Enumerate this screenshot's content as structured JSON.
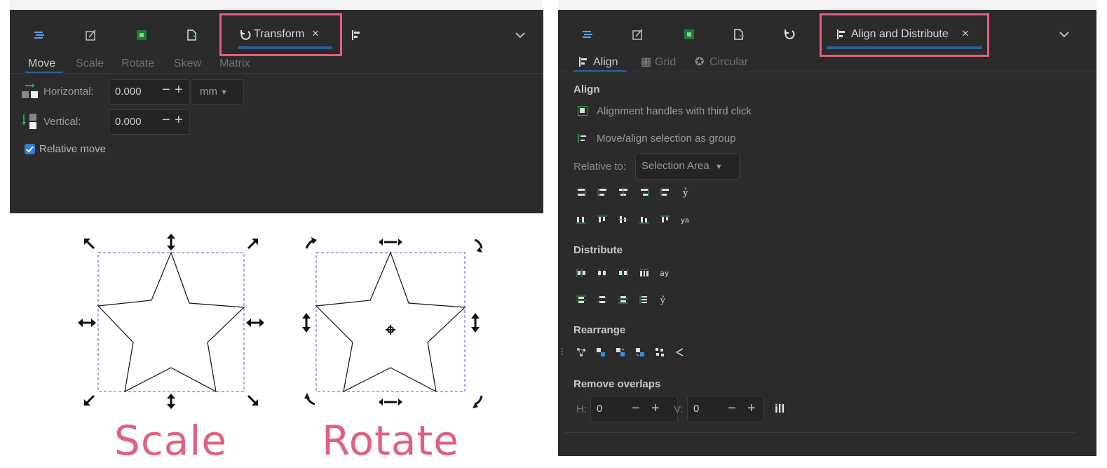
{
  "transform_panel": {
    "tab_label": "Transform",
    "close_glyph": "×",
    "subtabs": [
      "Move",
      "Scale",
      "Rotate",
      "Skew",
      "Matrix"
    ],
    "horizontal_label": "Horizontal:",
    "horizontal_value": "0.000",
    "vertical_label": "Vertical:",
    "vertical_value": "0.000",
    "unit": "mm",
    "relative_move_label": "Relative move",
    "relative_move_checked": true,
    "minus": "−",
    "plus": "+"
  },
  "align_panel": {
    "tab_label": "Align and Distribute",
    "close_glyph": "×",
    "subtabs": [
      "Align",
      "Grid",
      "Circular"
    ],
    "align_heading": "Align",
    "handles_label": "Alignment handles with third click",
    "group_label": "Move/align selection as group",
    "relative_label": "Relative to:",
    "relative_value": "Selection Area",
    "distribute_heading": "Distribute",
    "rearrange_heading": "Rearrange",
    "remove_overlaps_heading": "Remove overlaps",
    "h_label": "H:",
    "h_value": "0",
    "v_label": "V:",
    "v_value": "0",
    "minus": "−",
    "plus": "+",
    "apply_glyph": "ill"
  },
  "captions": {
    "scale": "Scale",
    "rotate": "Rotate"
  },
  "colors": {
    "highlight": "#e0607e",
    "panel_bg": "#2b2b2b",
    "tab_underline": "#2d5d9a",
    "accent_green": "#2da44e"
  }
}
